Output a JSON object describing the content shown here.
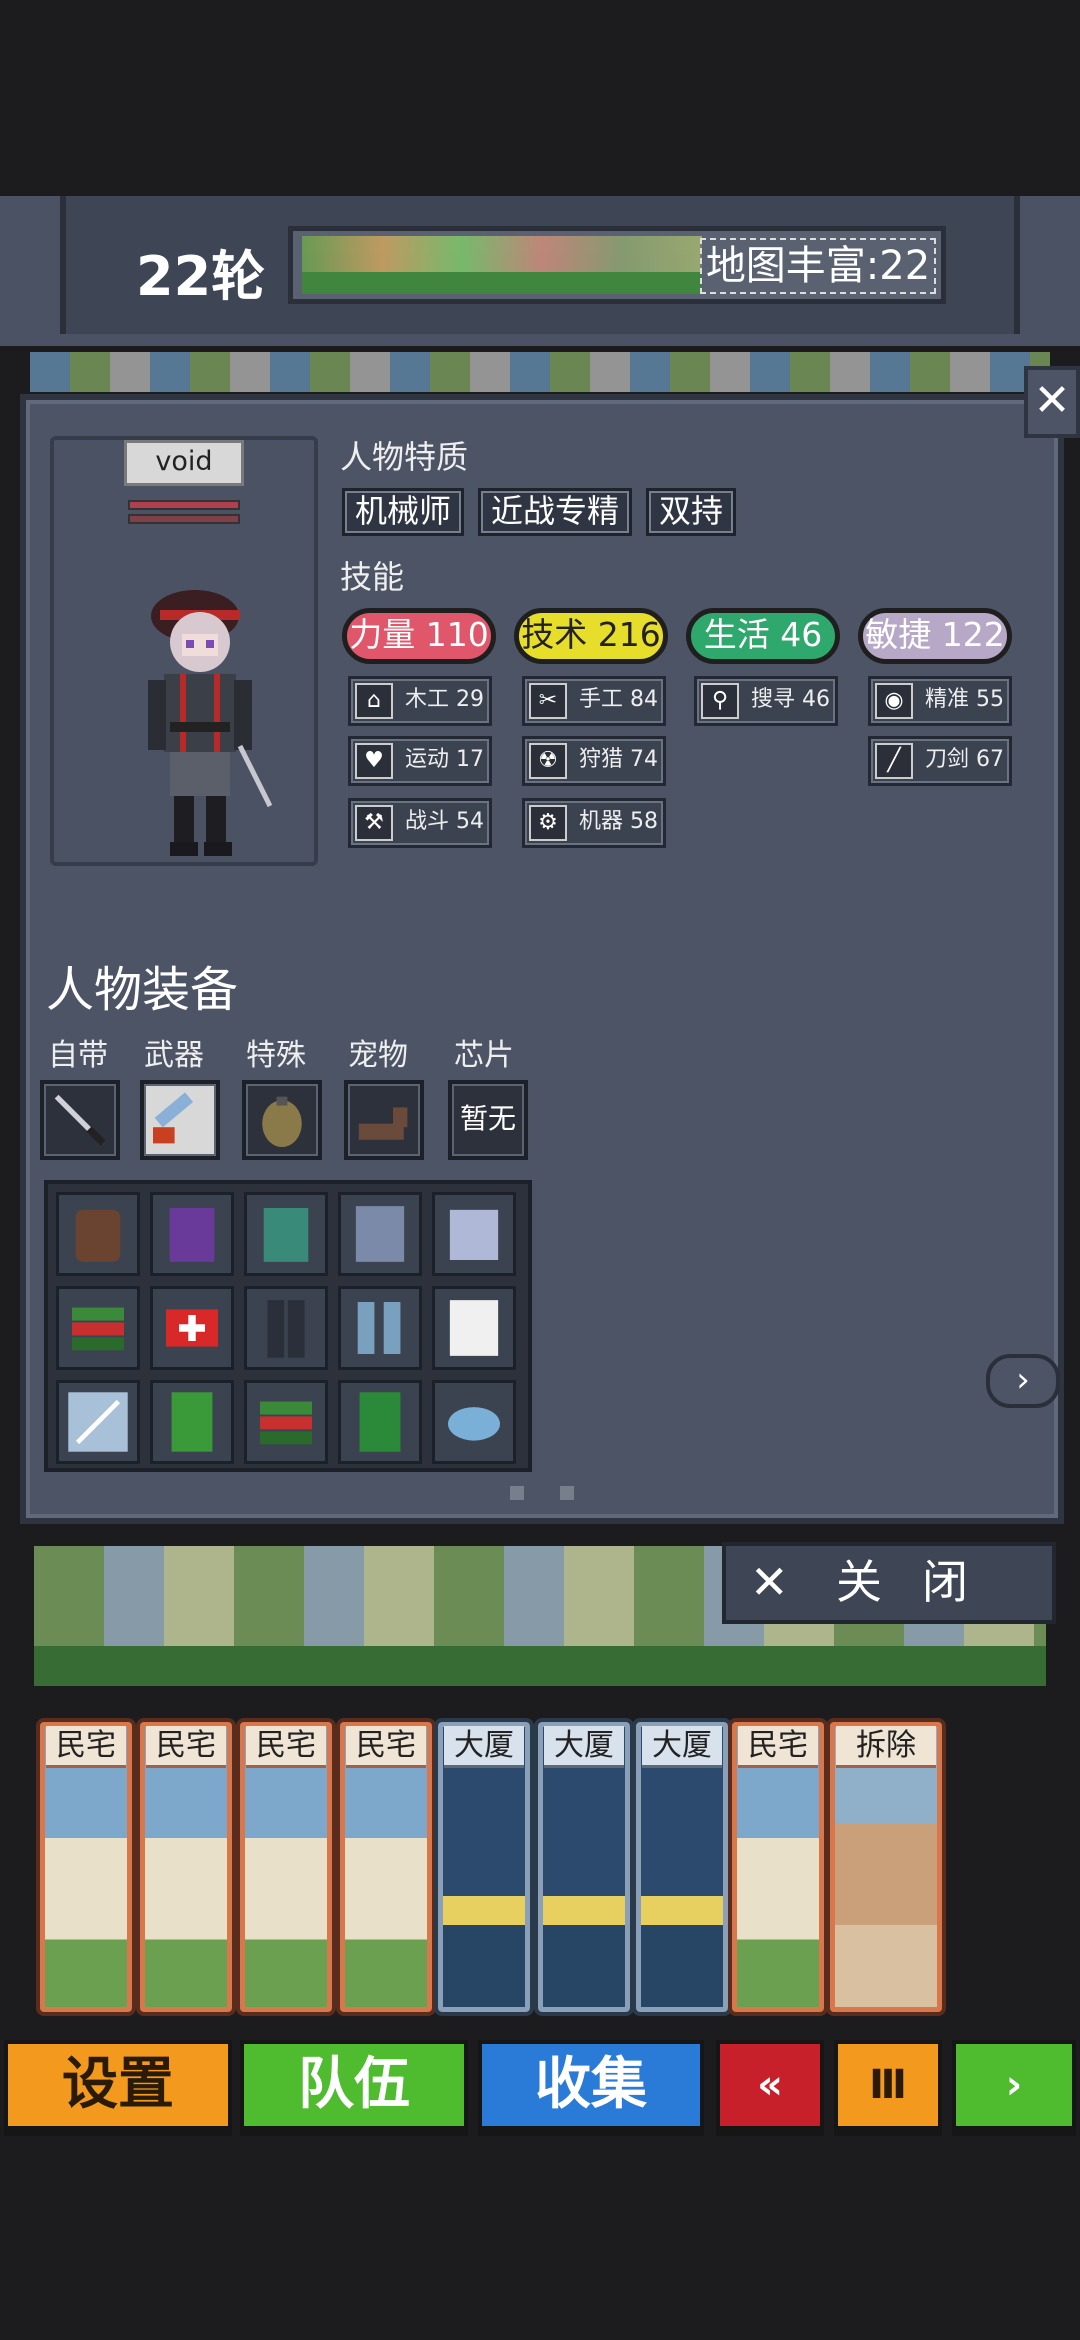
{
  "hud": {
    "round": "22轮",
    "map_richness": "地图丰富:22"
  },
  "character": {
    "name": "void"
  },
  "traits": {
    "title": "人物特质",
    "items": [
      "机械师",
      "近战专精",
      "双持"
    ]
  },
  "skills": {
    "title": "技能",
    "stats": [
      {
        "label": "力量 110",
        "color": "#e0566a"
      },
      {
        "label": "技术 216",
        "color": "#e6de2a"
      },
      {
        "label": "生活 46",
        "color": "#2ea86c"
      },
      {
        "label": "敏捷 122",
        "color": "#b8a8c8"
      }
    ],
    "items": [
      {
        "label": "木工 29",
        "icon": "house-icon"
      },
      {
        "label": "手工 84",
        "icon": "scissors-icon"
      },
      {
        "label": "搜寻 46",
        "icon": "magnifier-icon"
      },
      {
        "label": "精准 55",
        "icon": "eye-icon"
      },
      {
        "label": "运动 17",
        "icon": "heart-icon"
      },
      {
        "label": "狩猎 74",
        "icon": "radiation-icon"
      },
      {
        "label": "刀剑 67",
        "icon": "blade-icon"
      },
      {
        "label": "战斗 54",
        "icon": "wrench-icon"
      },
      {
        "label": "机器 58",
        "icon": "gear-icon"
      }
    ]
  },
  "equipment": {
    "title": "人物装备",
    "slots": [
      "自带",
      "武器",
      "特殊",
      "宠物",
      "芯片"
    ],
    "chip_value": "暂无"
  },
  "buttons": {
    "close": "关闭"
  },
  "cards": [
    "民宅",
    "民宅",
    "民宅",
    "民宅",
    "大厦",
    "大厦",
    "大厦",
    "民宅",
    "拆除"
  ],
  "bottom": {
    "settings": "设置",
    "team": "队伍",
    "collect": "收集"
  }
}
